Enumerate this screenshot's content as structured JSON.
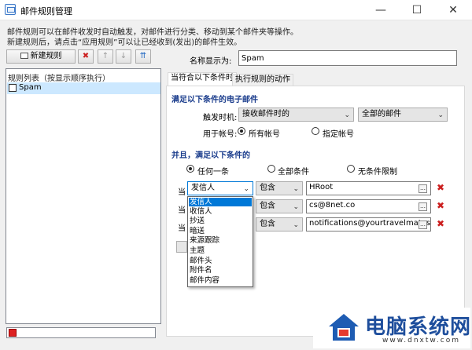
{
  "window": {
    "title": "邮件规则管理",
    "minimize": "—",
    "maximize": "☐",
    "close": "✕"
  },
  "description": {
    "line1": "邮件规则可以在邮件收发时自动触发，对邮件进行分类、移动到某个邮件夹等操作。",
    "line2": "新建规则后，请点击“应用规则”可以让已经收到(发出)的邮件生效。"
  },
  "toolbar": {
    "new_rule": "新建规则",
    "delete": "✖",
    "up": "↑",
    "down": "↓",
    "top": "⇈"
  },
  "rule_list": {
    "header": "规则列表（按显示顺序执行）",
    "items": [
      {
        "label": "Spam",
        "checked": false
      }
    ]
  },
  "name": {
    "label": "名称显示为:",
    "value": "Spam"
  },
  "tabs": [
    {
      "label": "当符合以下条件时",
      "active": true
    },
    {
      "label": "执行规则的动作",
      "active": false
    }
  ],
  "section1": {
    "title": "满足以下条件的电子邮件",
    "trigger_label": "触发时机:",
    "trigger_value": "接收邮件时的",
    "mail_scope": "全部的邮件",
    "account_label": "用于帐号:",
    "account_options": [
      {
        "label": "所有帐号",
        "selected": true
      },
      {
        "label": "指定帐号",
        "selected": false
      }
    ]
  },
  "section2": {
    "title": "并且，满足以下条件的",
    "match_options": [
      {
        "label": "任何一条",
        "selected": true
      },
      {
        "label": "全部条件",
        "selected": false
      },
      {
        "label": "无条件限制",
        "selected": false
      }
    ],
    "conditions": [
      {
        "prefix": "当",
        "field": "发信人",
        "op": "包含",
        "value": "HRoot"
      },
      {
        "prefix": "当",
        "field": "发信人",
        "op": "包含",
        "value": "cs@8net.co"
      },
      {
        "prefix": "当",
        "field": "发信人",
        "op": "包含",
        "value": "notifications@yourtravelmates.c"
      }
    ]
  },
  "dropdown": {
    "items": [
      {
        "label": "发信人",
        "selected": true
      },
      {
        "label": "收信人"
      },
      {
        "label": "抄送"
      },
      {
        "label": "暗送"
      },
      {
        "label": "来源跟踪"
      },
      {
        "label": "主题"
      },
      {
        "label": "邮件头"
      },
      {
        "label": "附件名"
      },
      {
        "label": "邮件内容"
      }
    ]
  },
  "watermark": {
    "text": "电脑系统网",
    "url": "www.dnxtw.com"
  },
  "colors": {
    "accent": "#0078d7",
    "section_title": "#1a3c8c",
    "delete": "#cc2020"
  }
}
